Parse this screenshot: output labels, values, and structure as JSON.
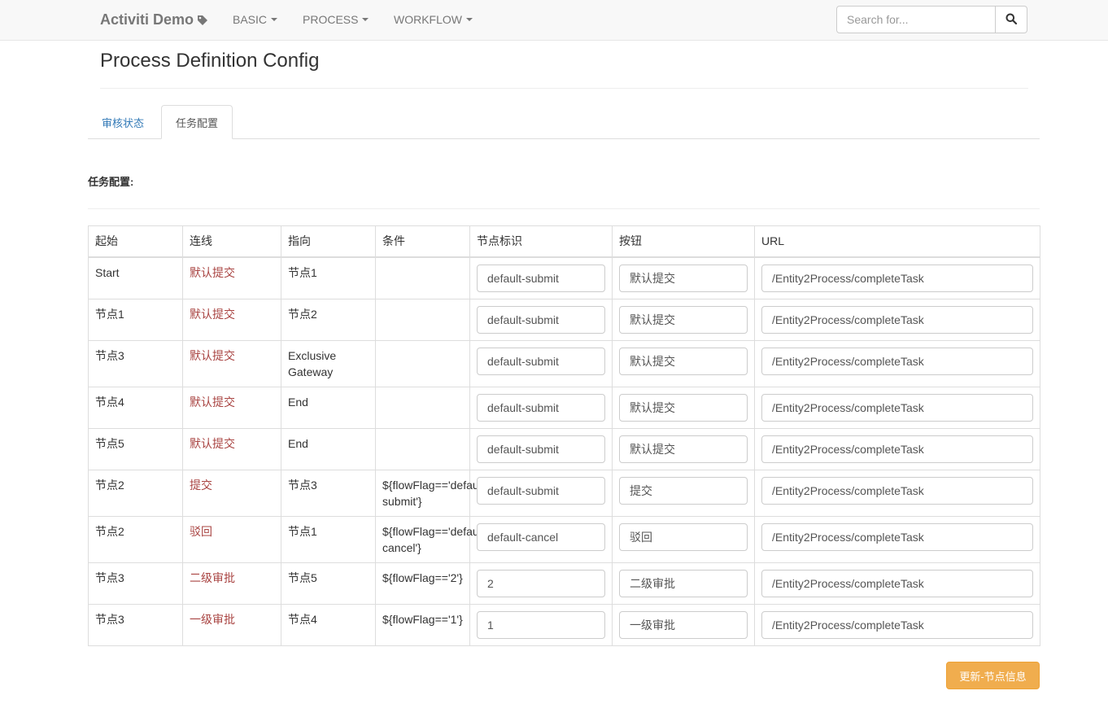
{
  "navbar": {
    "brand": "Activiti Demo",
    "brand_icon": "tag-icon",
    "menus": [
      "BASIC",
      "PROCESS",
      "WORKFLOW"
    ],
    "search": {
      "placeholder": "Search for...",
      "value": "",
      "button_icon": "search-icon"
    }
  },
  "page": {
    "title": "Process Definition Config"
  },
  "tabs": [
    {
      "label": "审核状态",
      "active": false
    },
    {
      "label": "任务配置",
      "active": true
    }
  ],
  "section": {
    "label": "任务配置:"
  },
  "table": {
    "headers": [
      "起始",
      "连线",
      "指向",
      "条件",
      "节点标识",
      "按钮",
      "URL"
    ],
    "rows": [
      {
        "start": "Start",
        "link": "默认提交",
        "target": "节点1",
        "condition": "",
        "node_id": "default-submit",
        "button": "默认提交",
        "url": "/Entity2Process/completeTask"
      },
      {
        "start": "节点1",
        "link": "默认提交",
        "target": "节点2",
        "condition": "",
        "node_id": "default-submit",
        "button": "默认提交",
        "url": "/Entity2Process/completeTask"
      },
      {
        "start": "节点3",
        "link": "默认提交",
        "target": "Exclusive Gateway",
        "condition": "",
        "node_id": "default-submit",
        "button": "默认提交",
        "url": "/Entity2Process/completeTask"
      },
      {
        "start": "节点4",
        "link": "默认提交",
        "target": "End",
        "condition": "",
        "node_id": "default-submit",
        "button": "默认提交",
        "url": "/Entity2Process/completeTask"
      },
      {
        "start": "节点5",
        "link": "默认提交",
        "target": "End",
        "condition": "",
        "node_id": "default-submit",
        "button": "默认提交",
        "url": "/Entity2Process/completeTask"
      },
      {
        "start": "节点2",
        "link": "提交",
        "target": "节点3",
        "condition": "${flowFlag=='default-submit'}",
        "node_id": "default-submit",
        "button": "提交",
        "url": "/Entity2Process/completeTask"
      },
      {
        "start": "节点2",
        "link": "驳回",
        "target": "节点1",
        "condition": "${flowFlag=='default-cancel'}",
        "node_id": "default-cancel",
        "button": "驳回",
        "url": "/Entity2Process/completeTask"
      },
      {
        "start": "节点3",
        "link": "二级审批",
        "target": "节点5",
        "condition": "${flowFlag=='2'}",
        "node_id": "2",
        "button": "二级审批",
        "url": "/Entity2Process/completeTask"
      },
      {
        "start": "节点3",
        "link": "一级审批",
        "target": "节点4",
        "condition": "${flowFlag=='1'}",
        "node_id": "1",
        "button": "一级审批",
        "url": "/Entity2Process/completeTask"
      }
    ]
  },
  "actions": {
    "update_label": "更新-节点信息"
  },
  "colors": {
    "link": "#a94442",
    "tab_link": "#337ab7",
    "warning_button": "#f0ad4e"
  }
}
